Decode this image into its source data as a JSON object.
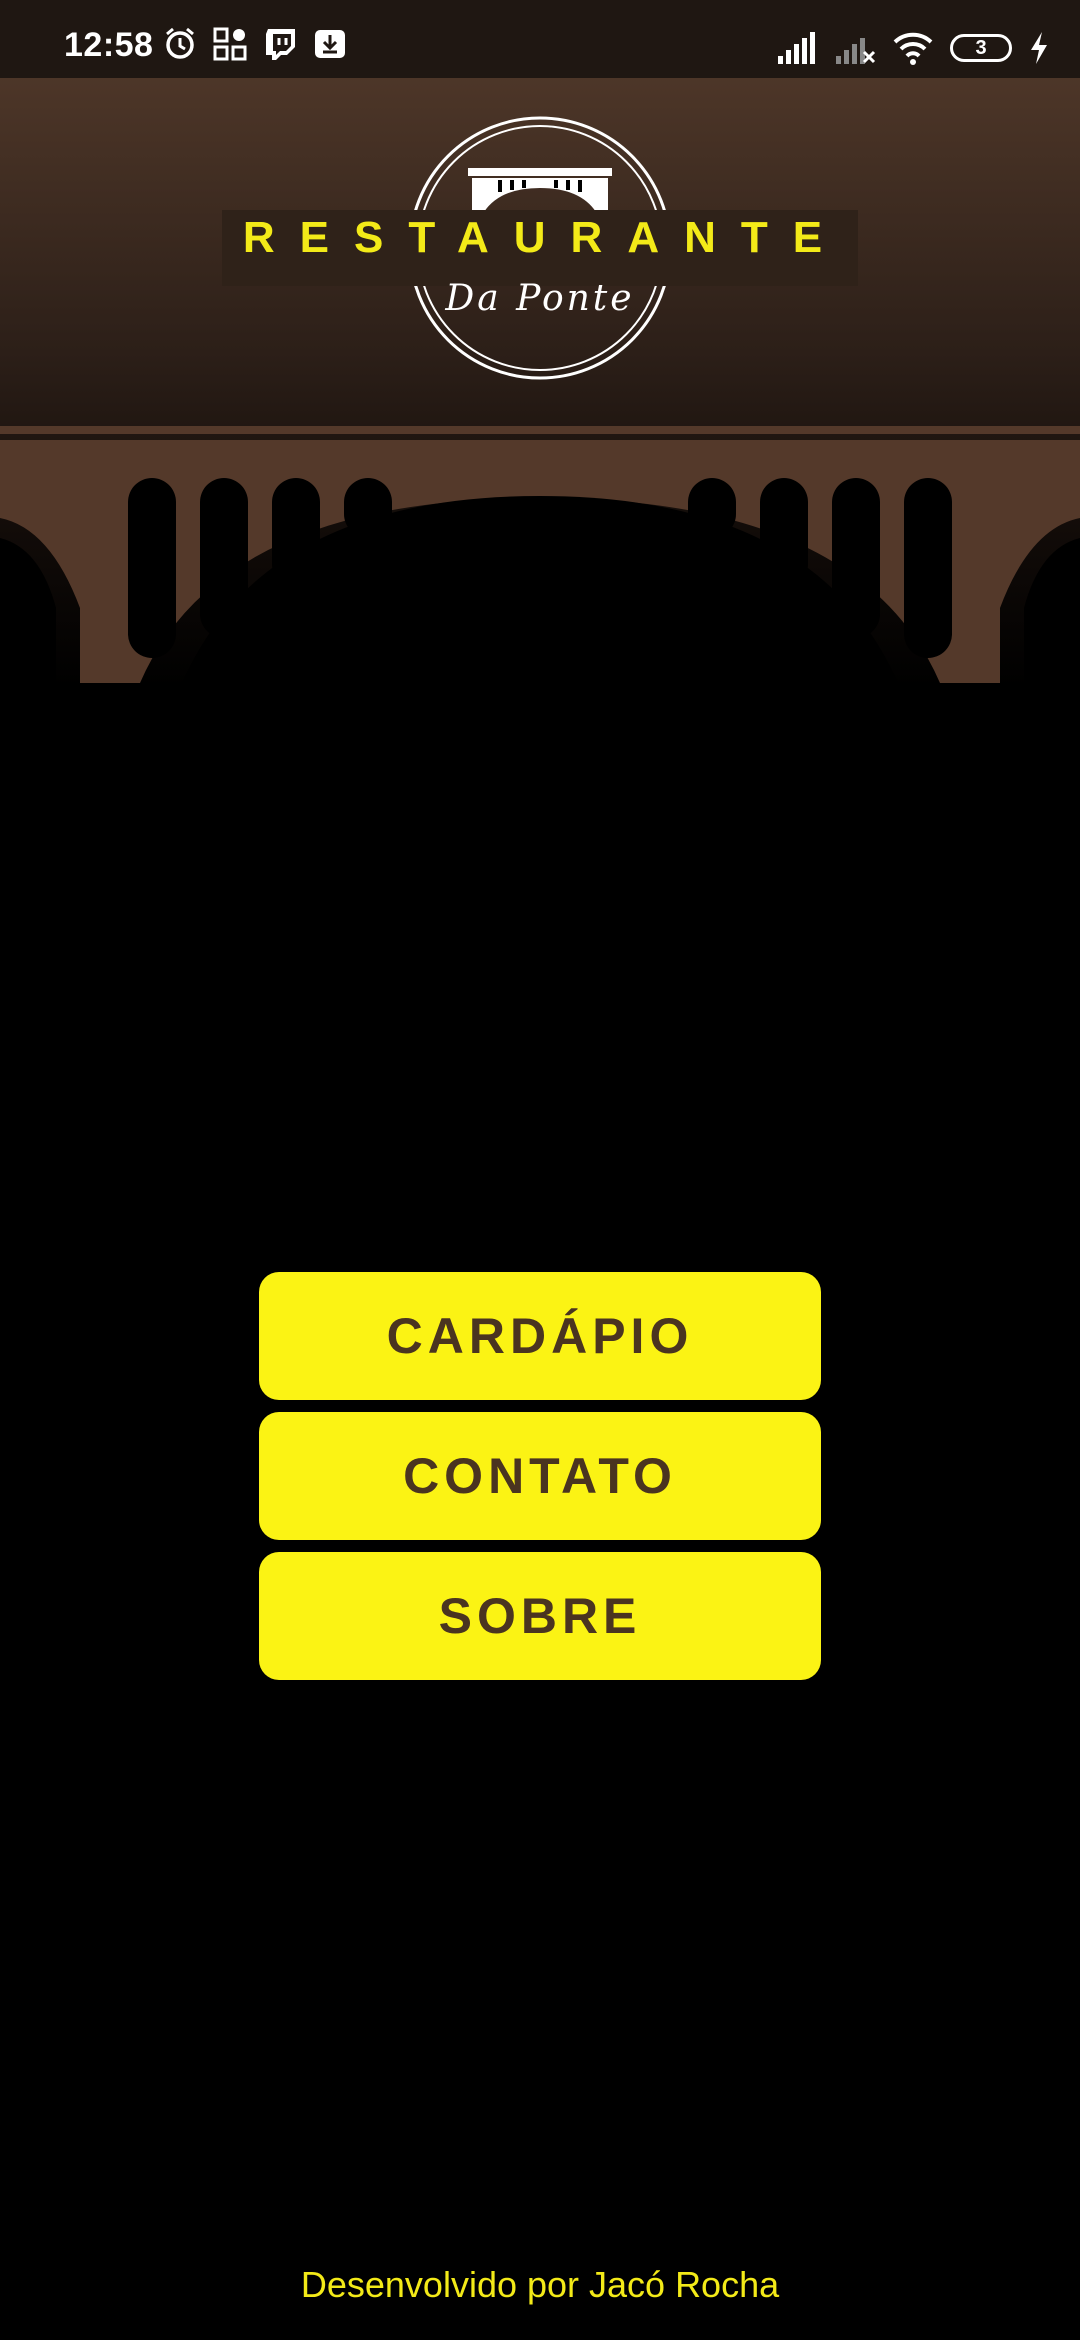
{
  "status_bar": {
    "time": "12:58",
    "battery_level": "3",
    "icons_left": [
      "alarm-icon",
      "qr-grid-icon",
      "twitch-icon",
      "download-icon"
    ],
    "icons_right": [
      "signal-icon",
      "signal-no-service-icon",
      "wifi-icon",
      "battery-icon",
      "charging-icon"
    ]
  },
  "logo": {
    "title": "RESTAURANTE",
    "subtitle": "Da Ponte"
  },
  "menu": {
    "cardapio": "CARDÁPIO",
    "contato": "CONTATO",
    "sobre": "SOBRE"
  },
  "footer": {
    "credit": "Desenvolvido por Jacó Rocha"
  },
  "colors": {
    "accent": "#fbf314",
    "button_text": "#4a3420",
    "bridge": "#54392a",
    "background": "#000000"
  }
}
